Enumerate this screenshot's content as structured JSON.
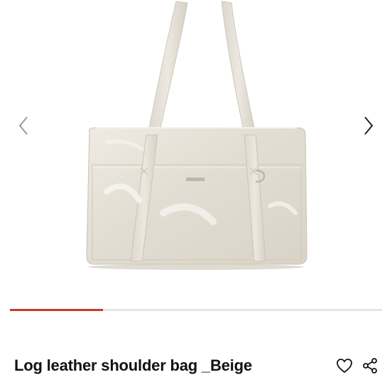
{
  "product": {
    "title": "Log leather shoulder bag _Beige",
    "brand_text": "",
    "colors": {
      "bag": "#e7e2d7",
      "bag_shadow": "#cfc8ba",
      "accent": "#c8392b",
      "track": "#e6e6e6"
    }
  },
  "gallery": {
    "prev_icon": "chevron-left-icon",
    "next_icon": "chevron-right-icon",
    "progress": 0.25
  },
  "actions": {
    "like_icon": "heart-outline-icon",
    "share_icon": "share-icon"
  }
}
